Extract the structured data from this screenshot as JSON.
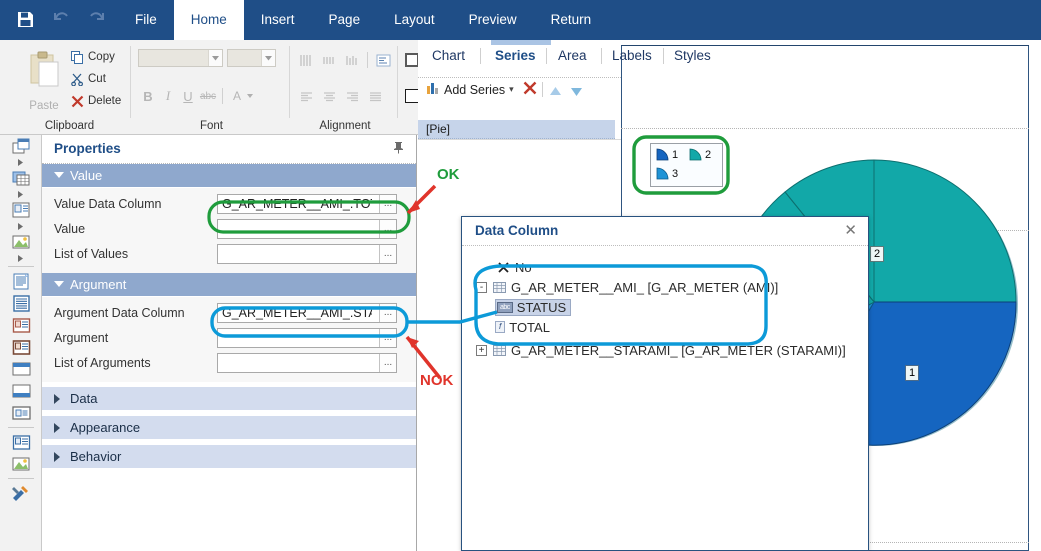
{
  "window": {
    "quick_access": [
      {
        "name": "save-icon",
        "label": "Save"
      },
      {
        "name": "undo-icon",
        "label": "Undo"
      },
      {
        "name": "redo-icon",
        "label": "Redo"
      }
    ],
    "tabs": [
      {
        "label": "File",
        "active": false
      },
      {
        "label": "Home",
        "active": true
      },
      {
        "label": "Insert",
        "active": false
      },
      {
        "label": "Page",
        "active": false
      },
      {
        "label": "Layout",
        "active": false
      },
      {
        "label": "Preview",
        "active": false
      },
      {
        "label": "Return",
        "active": false
      }
    ]
  },
  "ribbon": {
    "clipboard": {
      "group_label": "Clipboard",
      "paste_label": "Paste",
      "items": [
        {
          "label": "Copy",
          "icon": "copy-icon"
        },
        {
          "label": "Cut",
          "icon": "scissors-icon"
        },
        {
          "label": "Delete",
          "icon": "delete-x-icon"
        }
      ]
    },
    "font": {
      "group_label": "Font",
      "family_value": "",
      "size_value": "",
      "buttons": [
        "B",
        "I",
        "U",
        "abc",
        "A"
      ]
    },
    "alignment": {
      "group_label": "Alignment"
    }
  },
  "left_toolbar": {
    "items": [
      {
        "name": "tool-overlap-panels-icon"
      },
      {
        "name": "tool-table-panel-icon"
      },
      {
        "name": "tool-record-card-icon"
      },
      {
        "name": "tool-image-region-icon"
      },
      {
        "name": "tool-document-icon"
      },
      {
        "name": "tool-list-icon"
      },
      {
        "name": "tool-label-card-red-icon"
      },
      {
        "name": "tool-label-card-brown-icon"
      },
      {
        "name": "tool-header-band-icon"
      },
      {
        "name": "tool-footer-band-icon"
      },
      {
        "name": "tool-subreport-icon"
      },
      {
        "name": "tool-card-blue-icon"
      },
      {
        "name": "tool-picture-icon"
      },
      {
        "name": "tool-settings-wrench-icon"
      }
    ]
  },
  "properties": {
    "title": "Properties",
    "pin_icon": "pin-icon",
    "sections": [
      {
        "label": "Value",
        "expanded": true,
        "rows": [
          {
            "label": "Value Data Column",
            "value": "G_AR_METER__AMI_.TOTAl",
            "ellipsis": "..."
          },
          {
            "label": "Value",
            "value": "",
            "ellipsis": "..."
          },
          {
            "label": "List of Values",
            "value": "",
            "ellipsis": "..."
          }
        ]
      },
      {
        "label": "Argument",
        "expanded": true,
        "rows": [
          {
            "label": "Argument Data Column",
            "value": "G_AR_METER__AMI_.STATU",
            "ellipsis": "..."
          },
          {
            "label": "Argument",
            "value": "",
            "ellipsis": "..."
          },
          {
            "label": "List of Arguments",
            "value": "",
            "ellipsis": "..."
          }
        ]
      },
      {
        "label": "Data",
        "expanded": false,
        "rows": []
      },
      {
        "label": "Appearance",
        "expanded": false,
        "rows": []
      },
      {
        "label": "Behavior",
        "expanded": false,
        "rows": []
      }
    ]
  },
  "chart_panel": {
    "tabs": [
      {
        "label": "Chart",
        "active": false
      },
      {
        "label": "Series",
        "active": true
      },
      {
        "label": "Area",
        "active": false
      },
      {
        "label": "Labels",
        "active": false
      },
      {
        "label": "Styles",
        "active": false
      }
    ],
    "toolbar": {
      "add_series_label": "Add Series",
      "add_series_caret": "▾",
      "delete_icon": "delete-x-icon",
      "move_up_icon": "arrow-up-icon",
      "move_down_icon": "arrow-down-icon"
    },
    "series_list": [
      {
        "label": "[Pie]",
        "selected": true
      }
    ]
  },
  "dialog": {
    "title": "Data Column",
    "close_icon": "close-icon",
    "tree": [
      {
        "level": 0,
        "label": "No",
        "icon": "x-none-icon",
        "expander": null,
        "selected": false
      },
      {
        "level": 0,
        "label": "G_AR_METER__AMI_ [G_AR_METER (AMI)]",
        "icon": "table-icon",
        "expander": "-",
        "selected": false
      },
      {
        "level": 1,
        "label": "STATUS",
        "icon": "abc-column-icon",
        "expander": null,
        "selected": true
      },
      {
        "level": 1,
        "label": "TOTAL",
        "icon": "numeric-column-icon",
        "expander": null,
        "selected": false
      },
      {
        "level": 0,
        "label": "G_AR_METER__STARAMI_ [G_AR_METER (STARAMI)]",
        "icon": "table-icon",
        "expander": "+",
        "selected": false
      }
    ]
  },
  "annotations": [
    {
      "name": "ok-annotation",
      "text": "OK",
      "color": "#1f9c3c"
    },
    {
      "name": "nok-annotation",
      "text": "NOK",
      "color": "#e0342b"
    }
  ],
  "chart_data": {
    "type": "pie",
    "title": "",
    "categories": [
      "1",
      "2",
      "3"
    ],
    "values": [
      38,
      50,
      12
    ],
    "labels": [
      "1",
      "2",
      "3"
    ],
    "colors": [
      "#1565c0",
      "#12a8a8",
      "#1e93d6"
    ],
    "legend": {
      "position": "top-left",
      "entries": [
        {
          "label": "1",
          "color": "#1565c0"
        },
        {
          "label": "2",
          "color": "#12a8a8"
        },
        {
          "label": "3",
          "color": "#1e93d6"
        }
      ]
    },
    "data_labels": [
      {
        "label": "1",
        "color": "#1565c0"
      },
      {
        "label": "2",
        "color": "#12a8a8"
      }
    ]
  },
  "colors": {
    "ribbon_blue": "#1f4e87",
    "section_header": "#8fa8cd",
    "section_collapsed": "#d3dcee",
    "ok_green": "#1f9c3c",
    "nok_red": "#e0342b",
    "annotation_blue": "#0c9ad8"
  }
}
